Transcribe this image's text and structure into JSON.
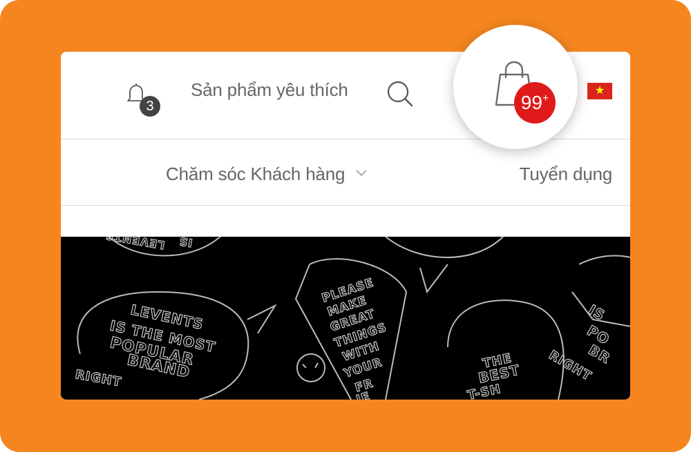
{
  "header": {
    "notifications": {
      "icon": "bell-icon",
      "count": "3"
    },
    "favorites_label": "Sản phẩm yêu thích",
    "search_icon": "search-icon",
    "cart": {
      "icon": "shopping-bag-icon",
      "count": "99",
      "count_suffix": "+"
    },
    "language_flag": "vietnam-flag-icon"
  },
  "nav": {
    "customer_care_label": "Chăm sóc Khách hàng",
    "customer_care_icon": "chevron-down-icon",
    "careers_label": "Tuyển dụng"
  },
  "banner": {
    "texts": {
      "bubble1": [
        "LEVENTS",
        "IS THE MOST",
        "POPULAR",
        "BRAND",
        "RIGHT"
      ],
      "bubble2": [
        "PLEASE",
        "MAKE",
        "GREAT",
        "THINGS",
        "WITH",
        "YOUR",
        "FR",
        "IE"
      ],
      "bubble3": [
        "THE",
        "BEST",
        "T-SH"
      ],
      "bubble4": [
        "IS",
        "PO",
        "BR",
        "RIGHT"
      ],
      "bubble5": [
        "LEVENTS",
        "IS"
      ]
    }
  },
  "colors": {
    "frame": "#f5861f",
    "badge_red": "#e01a1a",
    "notification_badge": "#444444",
    "text_gray": "#666666",
    "flag_red": "#da251d",
    "flag_star": "#ffff00"
  }
}
